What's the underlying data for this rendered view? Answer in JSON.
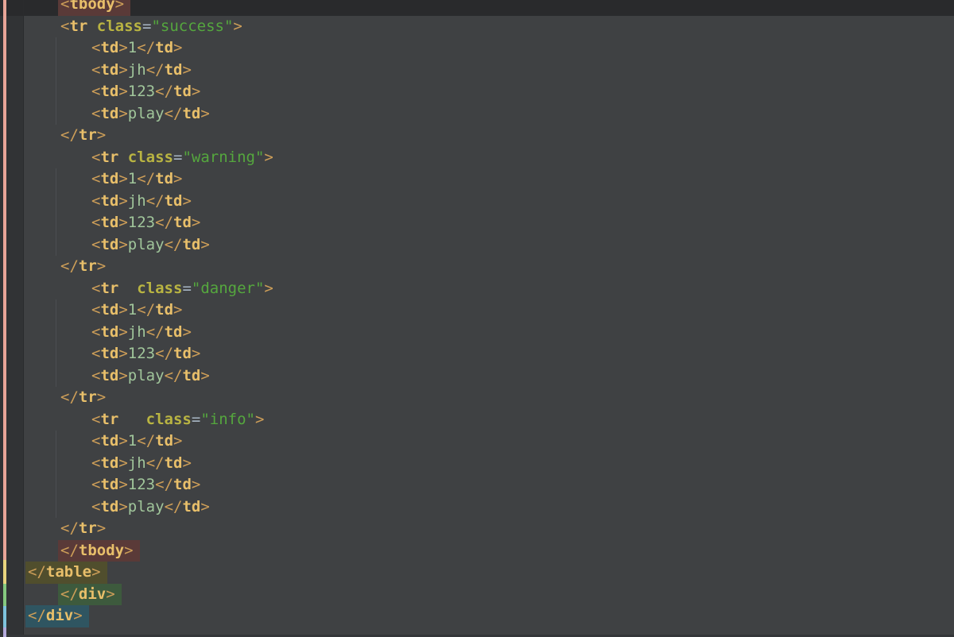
{
  "editor": {
    "language": "HTML",
    "colors": {
      "editor_bg": "#3f4143",
      "gutter_bg": "#313335",
      "gutter_border": "#2a2b2d",
      "caret_row": "#292a2c",
      "indent_guide": "#4b4e51",
      "bottom_edge": "#343639",
      "bracket": "#cd9e58",
      "tag": "#e8bf6a",
      "attr": "#b9b442",
      "eq": "#a9b7c6",
      "string": "#55a73e",
      "text": "#a1c69b",
      "hl_tbody": "#5a3a38",
      "hl_table": "#504e2d",
      "hl_div_green": "#3d5a3d",
      "hl_div_teal": "#2f5561",
      "stripe_salmon": "#e8a598",
      "stripe_yellow": "#e8d47e",
      "stripe_green": "#85c97f",
      "stripe_blue": "#7ec3dd",
      "stripe_lavender": "#b4aadb"
    },
    "change_markers": [
      {
        "name": "changed-lines-salmon",
        "color_key": "stripe_salmon",
        "from": 0,
        "to": 705
      },
      {
        "name": "changed-lines-yellow",
        "color_key": "stripe_yellow",
        "from": 705,
        "to": 735
      },
      {
        "name": "changed-lines-green",
        "color_key": "stripe_green",
        "from": 735,
        "to": 763
      },
      {
        "name": "changed-lines-blue",
        "color_key": "stripe_blue",
        "from": 763,
        "to": 790
      },
      {
        "name": "changed-lines-lavender",
        "color_key": "stripe_lavender",
        "from": 790,
        "to": 802
      }
    ],
    "indent_guides": [
      {
        "x": 70,
        "from": 47,
        "to": 157
      },
      {
        "x": 70,
        "from": 212,
        "to": 322
      },
      {
        "x": 70,
        "from": 377,
        "to": 487
      },
      {
        "x": 70,
        "from": 542,
        "to": 652
      }
    ],
    "lines": [
      {
        "indent": 1,
        "caret_row": true,
        "highlight": "tbody",
        "tokens": [
          [
            "<",
            "br"
          ],
          [
            "tbody",
            "tag"
          ],
          [
            ">",
            "br"
          ]
        ]
      },
      {
        "indent": 1,
        "tokens": [
          [
            "<",
            "br"
          ],
          [
            "tr",
            "tag"
          ],
          [
            " ",
            "plain"
          ],
          [
            "class",
            "attr"
          ],
          [
            "=",
            "eq"
          ],
          [
            "\"success\"",
            "str"
          ],
          [
            ">",
            "br"
          ]
        ]
      },
      {
        "indent": 2,
        "tokens": [
          [
            "<",
            "br"
          ],
          [
            "td",
            "tag"
          ],
          [
            ">",
            "br"
          ],
          [
            "1",
            "txt"
          ],
          [
            "</",
            "br"
          ],
          [
            "td",
            "tag"
          ],
          [
            ">",
            "br"
          ]
        ]
      },
      {
        "indent": 2,
        "tokens": [
          [
            "<",
            "br"
          ],
          [
            "td",
            "tag"
          ],
          [
            ">",
            "br"
          ],
          [
            "jh",
            "txt"
          ],
          [
            "</",
            "br"
          ],
          [
            "td",
            "tag"
          ],
          [
            ">",
            "br"
          ]
        ]
      },
      {
        "indent": 2,
        "tokens": [
          [
            "<",
            "br"
          ],
          [
            "td",
            "tag"
          ],
          [
            ">",
            "br"
          ],
          [
            "123",
            "txt"
          ],
          [
            "</",
            "br"
          ],
          [
            "td",
            "tag"
          ],
          [
            ">",
            "br"
          ]
        ]
      },
      {
        "indent": 2,
        "tokens": [
          [
            "<",
            "br"
          ],
          [
            "td",
            "tag"
          ],
          [
            ">",
            "br"
          ],
          [
            "play",
            "txt"
          ],
          [
            "</",
            "br"
          ],
          [
            "td",
            "tag"
          ],
          [
            ">",
            "br"
          ]
        ]
      },
      {
        "indent": 1,
        "tokens": [
          [
            "</",
            "br"
          ],
          [
            "tr",
            "tag"
          ],
          [
            ">",
            "br"
          ]
        ]
      },
      {
        "indent": 2,
        "tokens": [
          [
            "<",
            "br"
          ],
          [
            "tr",
            "tag"
          ],
          [
            " ",
            "plain"
          ],
          [
            "class",
            "attr"
          ],
          [
            "=",
            "eq"
          ],
          [
            "\"warning\"",
            "str"
          ],
          [
            ">",
            "br"
          ]
        ]
      },
      {
        "indent": 2,
        "tokens": [
          [
            "<",
            "br"
          ],
          [
            "td",
            "tag"
          ],
          [
            ">",
            "br"
          ],
          [
            "1",
            "txt"
          ],
          [
            "</",
            "br"
          ],
          [
            "td",
            "tag"
          ],
          [
            ">",
            "br"
          ]
        ]
      },
      {
        "indent": 2,
        "tokens": [
          [
            "<",
            "br"
          ],
          [
            "td",
            "tag"
          ],
          [
            ">",
            "br"
          ],
          [
            "jh",
            "txt"
          ],
          [
            "</",
            "br"
          ],
          [
            "td",
            "tag"
          ],
          [
            ">",
            "br"
          ]
        ]
      },
      {
        "indent": 2,
        "tokens": [
          [
            "<",
            "br"
          ],
          [
            "td",
            "tag"
          ],
          [
            ">",
            "br"
          ],
          [
            "123",
            "txt"
          ],
          [
            "</",
            "br"
          ],
          [
            "td",
            "tag"
          ],
          [
            ">",
            "br"
          ]
        ]
      },
      {
        "indent": 2,
        "tokens": [
          [
            "<",
            "br"
          ],
          [
            "td",
            "tag"
          ],
          [
            ">",
            "br"
          ],
          [
            "play",
            "txt"
          ],
          [
            "</",
            "br"
          ],
          [
            "td",
            "tag"
          ],
          [
            ">",
            "br"
          ]
        ]
      },
      {
        "indent": 1,
        "tokens": [
          [
            "</",
            "br"
          ],
          [
            "tr",
            "tag"
          ],
          [
            ">",
            "br"
          ]
        ]
      },
      {
        "indent": 2,
        "tokens": [
          [
            "<",
            "br"
          ],
          [
            "tr",
            "tag"
          ],
          [
            "  ",
            "plain"
          ],
          [
            "class",
            "attr"
          ],
          [
            "=",
            "eq"
          ],
          [
            "\"danger\"",
            "str"
          ],
          [
            ">",
            "br"
          ]
        ]
      },
      {
        "indent": 2,
        "tokens": [
          [
            "<",
            "br"
          ],
          [
            "td",
            "tag"
          ],
          [
            ">",
            "br"
          ],
          [
            "1",
            "txt"
          ],
          [
            "</",
            "br"
          ],
          [
            "td",
            "tag"
          ],
          [
            ">",
            "br"
          ]
        ]
      },
      {
        "indent": 2,
        "tokens": [
          [
            "<",
            "br"
          ],
          [
            "td",
            "tag"
          ],
          [
            ">",
            "br"
          ],
          [
            "jh",
            "txt"
          ],
          [
            "</",
            "br"
          ],
          [
            "td",
            "tag"
          ],
          [
            ">",
            "br"
          ]
        ]
      },
      {
        "indent": 2,
        "tokens": [
          [
            "<",
            "br"
          ],
          [
            "td",
            "tag"
          ],
          [
            ">",
            "br"
          ],
          [
            "123",
            "txt"
          ],
          [
            "</",
            "br"
          ],
          [
            "td",
            "tag"
          ],
          [
            ">",
            "br"
          ]
        ]
      },
      {
        "indent": 2,
        "tokens": [
          [
            "<",
            "br"
          ],
          [
            "td",
            "tag"
          ],
          [
            ">",
            "br"
          ],
          [
            "play",
            "txt"
          ],
          [
            "</",
            "br"
          ],
          [
            "td",
            "tag"
          ],
          [
            ">",
            "br"
          ]
        ]
      },
      {
        "indent": 1,
        "tokens": [
          [
            "</",
            "br"
          ],
          [
            "tr",
            "tag"
          ],
          [
            ">",
            "br"
          ]
        ]
      },
      {
        "indent": 2,
        "tokens": [
          [
            "<",
            "br"
          ],
          [
            "tr",
            "tag"
          ],
          [
            "   ",
            "plain"
          ],
          [
            "class",
            "attr"
          ],
          [
            "=",
            "eq"
          ],
          [
            "\"info\"",
            "str"
          ],
          [
            ">",
            "br"
          ]
        ]
      },
      {
        "indent": 2,
        "tokens": [
          [
            "<",
            "br"
          ],
          [
            "td",
            "tag"
          ],
          [
            ">",
            "br"
          ],
          [
            "1",
            "txt"
          ],
          [
            "</",
            "br"
          ],
          [
            "td",
            "tag"
          ],
          [
            ">",
            "br"
          ]
        ]
      },
      {
        "indent": 2,
        "tokens": [
          [
            "<",
            "br"
          ],
          [
            "td",
            "tag"
          ],
          [
            ">",
            "br"
          ],
          [
            "jh",
            "txt"
          ],
          [
            "</",
            "br"
          ],
          [
            "td",
            "tag"
          ],
          [
            ">",
            "br"
          ]
        ]
      },
      {
        "indent": 2,
        "tokens": [
          [
            "<",
            "br"
          ],
          [
            "td",
            "tag"
          ],
          [
            ">",
            "br"
          ],
          [
            "123",
            "txt"
          ],
          [
            "</",
            "br"
          ],
          [
            "td",
            "tag"
          ],
          [
            ">",
            "br"
          ]
        ]
      },
      {
        "indent": 2,
        "tokens": [
          [
            "<",
            "br"
          ],
          [
            "td",
            "tag"
          ],
          [
            ">",
            "br"
          ],
          [
            "play",
            "txt"
          ],
          [
            "</",
            "br"
          ],
          [
            "td",
            "tag"
          ],
          [
            ">",
            "br"
          ]
        ]
      },
      {
        "indent": 1,
        "tokens": [
          [
            "</",
            "br"
          ],
          [
            "tr",
            "tag"
          ],
          [
            ">",
            "br"
          ]
        ]
      },
      {
        "indent": 1,
        "highlight": "tbody",
        "tokens": [
          [
            "</",
            "br"
          ],
          [
            "tbody",
            "tag"
          ],
          [
            ">",
            "br"
          ]
        ]
      },
      {
        "indent": 0,
        "highlight": "table",
        "tokens": [
          [
            "</",
            "br"
          ],
          [
            "table",
            "tag"
          ],
          [
            ">",
            "br"
          ]
        ]
      },
      {
        "indent": 1,
        "highlight": "div-green",
        "tokens": [
          [
            "</",
            "br"
          ],
          [
            "div",
            "tag"
          ],
          [
            ">",
            "br"
          ]
        ]
      },
      {
        "indent": 0,
        "highlight": "div-teal",
        "tokens": [
          [
            "</",
            "br"
          ],
          [
            "div",
            "tag"
          ],
          [
            ">",
            "br"
          ]
        ]
      }
    ]
  }
}
